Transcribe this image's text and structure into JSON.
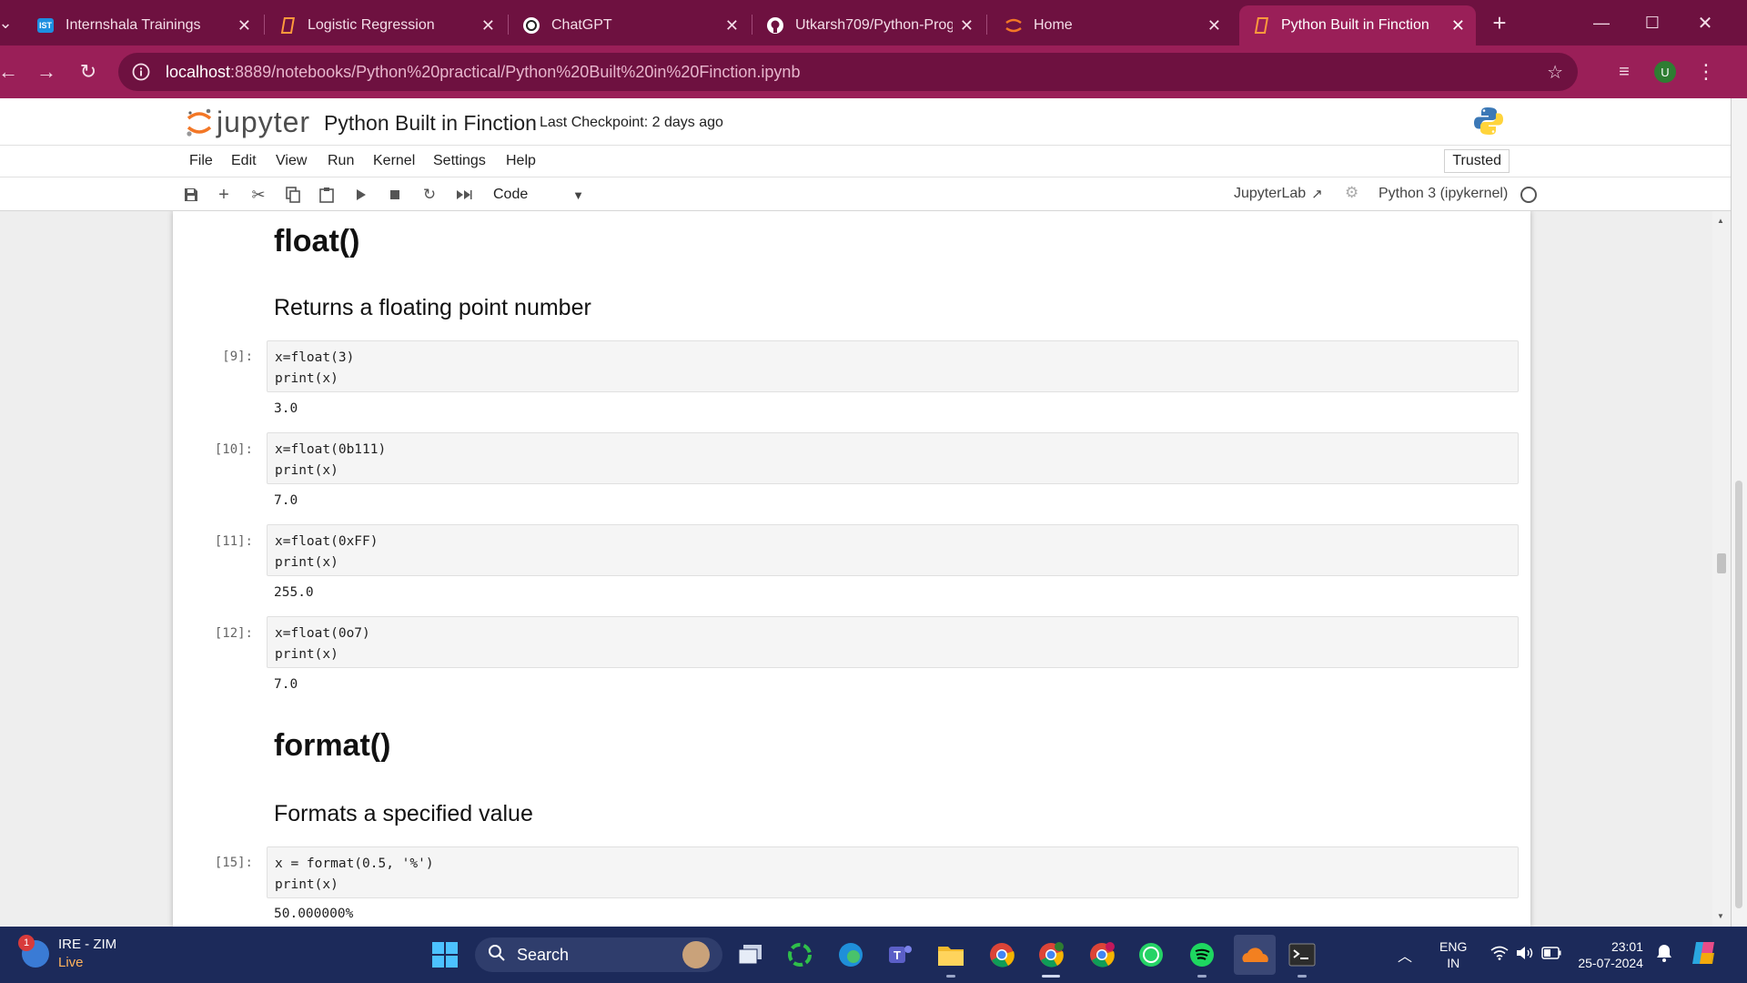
{
  "browser": {
    "tabs": [
      {
        "title": "Internshala Trainings",
        "icon": "internshala-icon"
      },
      {
        "title": "Logistic Regression",
        "icon": "jupyter-notebook-icon"
      },
      {
        "title": "ChatGPT",
        "icon": "chatgpt-icon"
      },
      {
        "title": "Utkarsh709/Python-Progra",
        "icon": "github-icon"
      },
      {
        "title": "Home",
        "icon": "jupyter-icon"
      },
      {
        "title": "Python Built in Finction",
        "icon": "jupyter-notebook-icon",
        "active": true
      }
    ],
    "url_host": "localhost",
    "url_rest": ":8889/notebooks/Python%20practical/Python%20Built%20in%20Finction.ipynb",
    "profile_initial": "U",
    "theme_color": "#9a1f58",
    "tabbar_color": "#6e1140",
    "internshala_favicon_text": "IST"
  },
  "jupyter": {
    "logo_text": "jupyter",
    "notebook_title": "Python Built in Finction",
    "checkpoint": "Last Checkpoint: 2 days ago",
    "menu": [
      "File",
      "Edit",
      "View",
      "Run",
      "Kernel",
      "Settings",
      "Help"
    ],
    "trusted": "Trusted",
    "cell_type": "Code",
    "jupyterlab_link": "JupyterLab",
    "kernel": "Python 3 (ipykernel)"
  },
  "notebook": {
    "float_heading": "float()",
    "float_desc": "Returns a floating point number",
    "format_heading": "format()",
    "format_desc": "Formats a specified value",
    "cells": [
      {
        "prompt": "[9]:",
        "line1": "x=float(3)",
        "line2": "print(x)",
        "output": "3.0"
      },
      {
        "prompt": "[10]:",
        "line1": "x=float(0b111)",
        "line2": "print(x)",
        "output": "7.0"
      },
      {
        "prompt": "[11]:",
        "line1": "x=float(0xFF)",
        "line2": "print(x)",
        "output": "255.0"
      },
      {
        "prompt": "[12]:",
        "line1": "x=float(0o7)",
        "line2": "print(x)",
        "output": "7.0"
      },
      {
        "prompt": "[15]:",
        "line1": "x = format(0.5, '%')",
        "line2": "print(x)",
        "output": "50.000000%"
      }
    ]
  },
  "taskbar": {
    "weather_title": "IRE - ZIM",
    "weather_sub": "Live",
    "weather_badge": "1",
    "search_placeholder": "Search",
    "lang_top": "ENG",
    "lang_bottom": "IN",
    "time": "23:01",
    "date": "25-07-2024"
  }
}
